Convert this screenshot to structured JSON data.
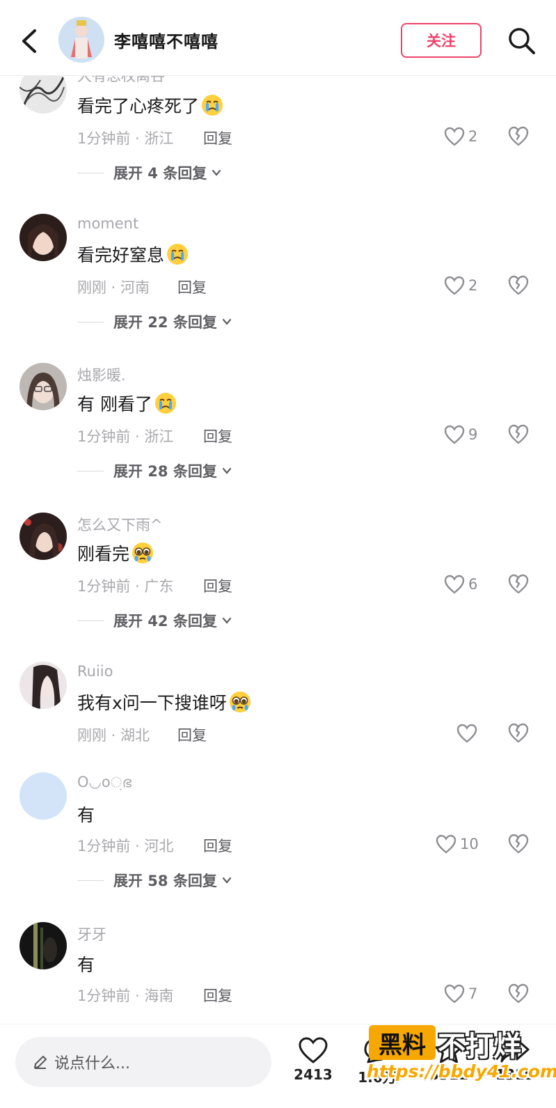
{
  "header": {
    "title": "李嘻嘻不嘻嘻",
    "follow_label": "关注"
  },
  "partial_top_username": "大有思权离谷",
  "comments": [
    {
      "username": "",
      "text": "看完了心疼死了",
      "emoji": "crying-face",
      "time": "1分钟前",
      "location": "浙江",
      "reply_label": "回复",
      "likes": "2",
      "expand": "展开 4 条回复"
    },
    {
      "username": "moment",
      "text": "看完好窒息",
      "emoji": "crying-face",
      "time": "刚刚",
      "location": "河南",
      "reply_label": "回复",
      "likes": "2",
      "expand": "展开 22 条回复"
    },
    {
      "username": "烛影暖.",
      "text": "有 刚看了",
      "emoji": "crying-face",
      "time": "1分钟前",
      "location": "浙江",
      "reply_label": "回复",
      "likes": "9",
      "expand": "展开 28 条回复"
    },
    {
      "username": "怎么又下雨^",
      "text": "刚看完",
      "emoji": "pleading-face",
      "time": "1分钟前",
      "location": "广东",
      "reply_label": "回复",
      "likes": "6",
      "expand": "展开 42 条回复"
    },
    {
      "username": "Ruiio",
      "text": "我有x问一下搜谁呀",
      "emoji": "pleading-face",
      "time": "刚刚",
      "location": "湖北",
      "reply_label": "回复",
      "likes": "",
      "expand": ""
    },
    {
      "username": "O◡o਼ഭ",
      "text": "有",
      "emoji": "",
      "time": "1分钟前",
      "location": "河北",
      "reply_label": "回复",
      "likes": "10",
      "expand": "展开 58 条回复"
    },
    {
      "username": "牙牙",
      "text": "有",
      "emoji": "",
      "time": "1分钟前",
      "location": "海南",
      "reply_label": "回复",
      "likes": "7",
      "expand": ""
    }
  ],
  "bottom_bar": {
    "input_placeholder": "说点什么...",
    "like_count": "2413",
    "comment_count": "1.6万",
    "star_count": "3311",
    "share_count": "1319"
  },
  "watermark": {
    "badge": "黑料",
    "title": "不打烊",
    "url": "https://bbdy41.com"
  },
  "colors": {
    "accent": "#f0426a",
    "secondary_text": "#a9a9ad",
    "watermark_orange": "#f6a800"
  }
}
